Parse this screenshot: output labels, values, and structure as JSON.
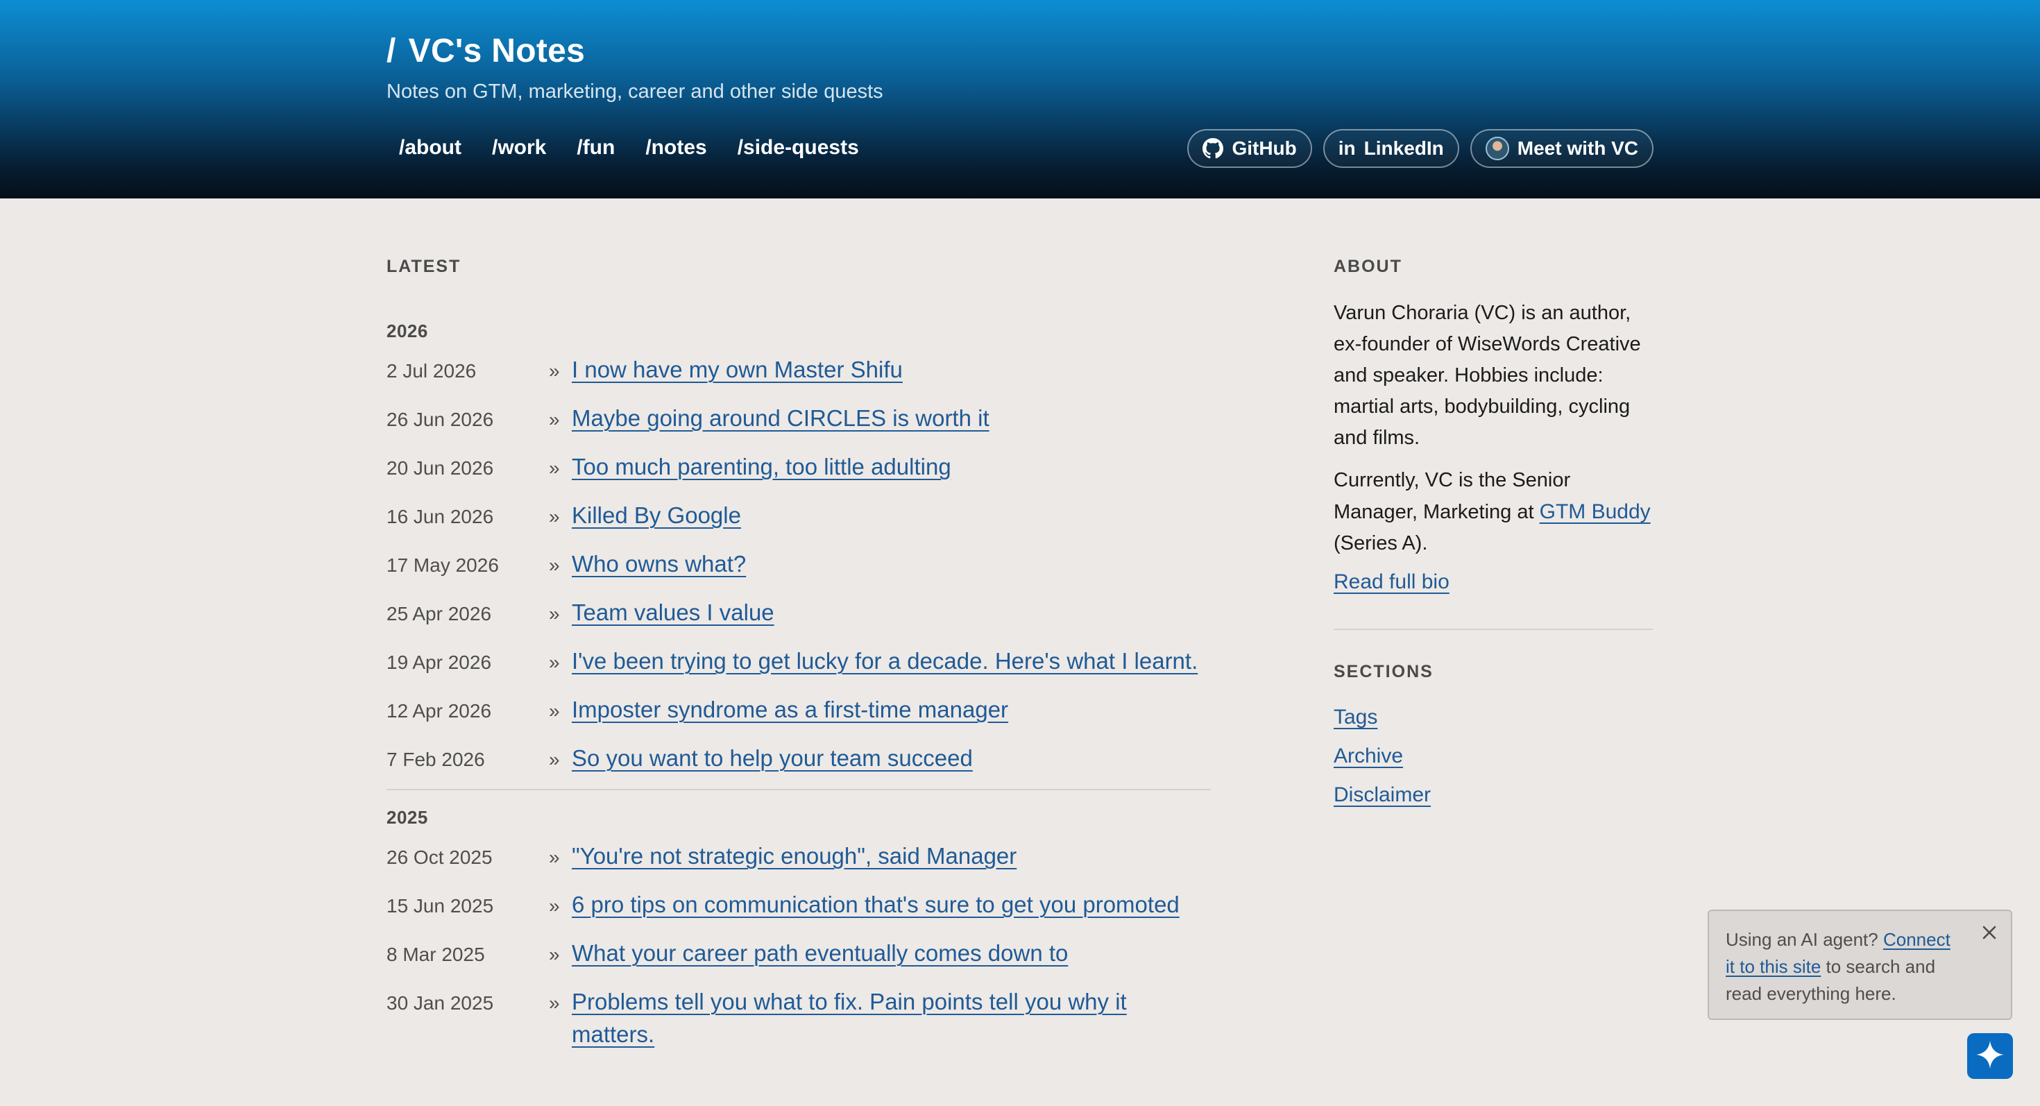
{
  "header": {
    "slash": "/",
    "title": "VC's Notes",
    "tagline": "Notes on GTM, marketing, career and other side quests",
    "nav": [
      "/about",
      "/work",
      "/fun",
      "/notes",
      "/side-quests"
    ],
    "social": {
      "github": "GitHub",
      "linkedin": "LinkedIn",
      "linkedin_glyph": "in",
      "meet": "Meet with VC"
    }
  },
  "latest": {
    "label": "LATEST",
    "bullet": "»",
    "groups": [
      {
        "year": "2026",
        "posts": [
          {
            "date": "2 Jul 2026",
            "title": "I now have my own Master Shifu"
          },
          {
            "date": "26 Jun 2026",
            "title": "Maybe going around CIRCLES is worth it"
          },
          {
            "date": "20 Jun 2026",
            "title": "Too much parenting, too little adulting"
          },
          {
            "date": "16 Jun 2026",
            "title": "Killed By Google"
          },
          {
            "date": "17 May 2026",
            "title": "Who owns what?"
          },
          {
            "date": "25 Apr 2026",
            "title": "Team values I value"
          },
          {
            "date": "19 Apr 2026",
            "title": "I've been trying to get lucky for a decade. Here's what I learnt."
          },
          {
            "date": "12 Apr 2026",
            "title": "Imposter syndrome as a first-time manager"
          },
          {
            "date": "7 Feb 2026",
            "title": "So you want to help your team succeed"
          }
        ]
      },
      {
        "year": "2025",
        "posts": [
          {
            "date": "26 Oct 2025",
            "title": "\"You're not strategic enough\", said Manager"
          },
          {
            "date": "15 Jun 2025",
            "title": "6 pro tips on communication that's sure to get you promoted"
          },
          {
            "date": "8 Mar 2025",
            "title": "What your career path eventually comes down to"
          },
          {
            "date": "30 Jan 2025",
            "title": "Problems tell you what to fix. Pain points tell you why it matters."
          }
        ]
      }
    ]
  },
  "about": {
    "label": "ABOUT",
    "bio": "Varun Choraria (VC) is an author, ex-founder of WiseWords Creative and speaker. Hobbies include: martial arts, bodybuilding, cycling and films.",
    "current_prefix": "Currently, VC is the Senior Manager, Marketing at ",
    "company_link": "GTM Buddy",
    "current_suffix": " (Series A).",
    "read_bio": "Read full bio"
  },
  "sections": {
    "label": "SECTIONS",
    "links": [
      "Tags",
      "Archive",
      "Disclaimer"
    ]
  },
  "toast": {
    "prefix": "Using an AI agent? ",
    "link": "Connect it to this site",
    "suffix": " to search and read everything here."
  },
  "colors": {
    "link": "#1f5a96",
    "header_top": "#0d8ed3",
    "header_bottom": "#050e17",
    "background": "#ede9e6",
    "fab": "#0a6cc0"
  },
  "icons": [
    "github-icon",
    "linkedin-icon",
    "avatar",
    "close-icon",
    "sparkle-icon"
  ]
}
